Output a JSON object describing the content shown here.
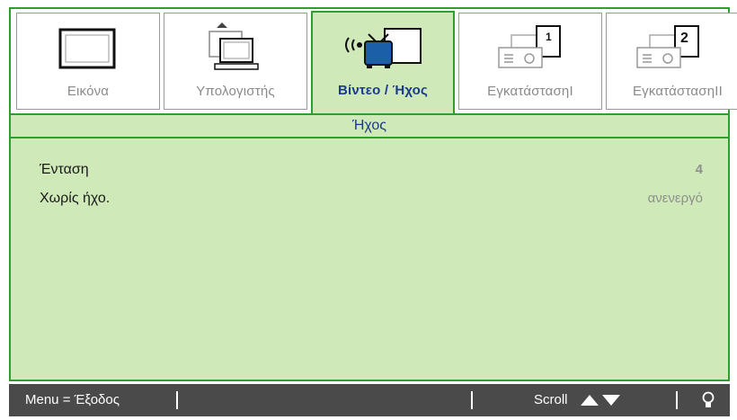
{
  "tabs": [
    {
      "label": "Εικόνα",
      "icon": "monitor-icon"
    },
    {
      "label": "Υπολογιστής",
      "icon": "computer-icon"
    },
    {
      "label": "Βίντεο / Ήχος",
      "icon": "tv-sound-icon"
    },
    {
      "label": "ΕγκατάστασηΙ",
      "icon": "projector-setup-1-icon"
    },
    {
      "label": "ΕγκατάστασηΙΙ",
      "icon": "projector-setup-2-icon"
    }
  ],
  "active_tab_index": 2,
  "section_title": "Ήχος",
  "items": [
    {
      "name": "Ένταση",
      "value": "4"
    },
    {
      "name": "Χωρίς ήχο.",
      "value": "ανενεργό"
    }
  ],
  "footer": {
    "menu": "Menu = Έξοδος",
    "scroll": "Scroll",
    "scroll_icon": "up-down-arrows-icon",
    "lamp_icon": "lamp-icon"
  },
  "colors": {
    "accent_green": "#2f9e2f",
    "panel_bg": "#cfe9b8",
    "active_text": "#1b3a8c",
    "footer_bg": "#4a4a4a"
  }
}
